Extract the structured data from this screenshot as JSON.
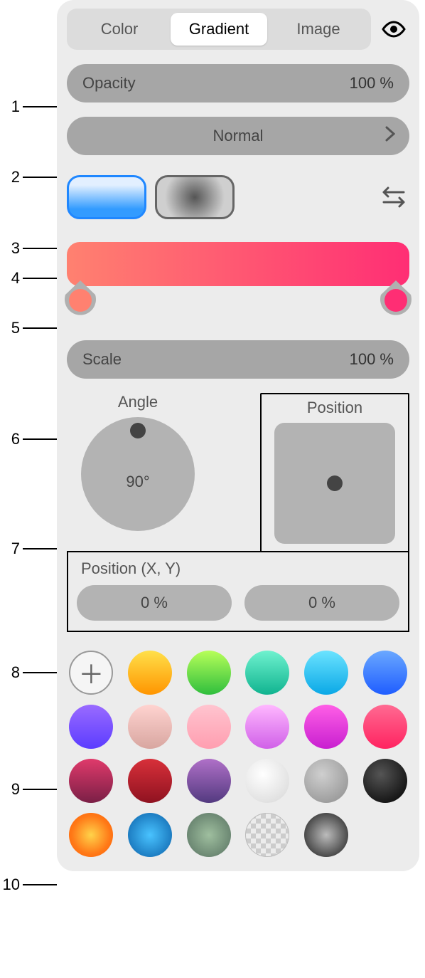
{
  "callouts": [
    "1",
    "2",
    "3",
    "4",
    "5",
    "6",
    "7",
    "8",
    "9",
    "10"
  ],
  "tabs": {
    "color": "Color",
    "gradient": "Gradient",
    "image": "Image",
    "active": "gradient"
  },
  "opacity": {
    "label": "Opacity",
    "value": "100 %"
  },
  "blend": {
    "label": "Normal"
  },
  "gradient": {
    "start_color": "#ff8170",
    "end_color": "#ff2e74"
  },
  "scale": {
    "label": "Scale",
    "value": "100 %"
  },
  "angle": {
    "label": "Angle",
    "value": "90°"
  },
  "position": {
    "label": "Position"
  },
  "position_xy": {
    "label": "Position (X, Y)",
    "x": "0 %",
    "y": "0 %"
  },
  "swatches": [
    {
      "name": "add",
      "type": "add"
    },
    {
      "name": "orange-yellow",
      "css": "linear-gradient(180deg,#ffe04a,#ff9500)"
    },
    {
      "name": "green",
      "css": "linear-gradient(180deg,#b7ff59,#2fbe3d)"
    },
    {
      "name": "teal",
      "css": "linear-gradient(180deg,#6ff2cf,#10b38f)"
    },
    {
      "name": "cyan",
      "css": "linear-gradient(180deg,#6be3ff,#0aa8e6)"
    },
    {
      "name": "blue",
      "css": "linear-gradient(180deg,#6aa8ff,#1f5dff)"
    },
    {
      "name": "violet",
      "css": "linear-gradient(180deg,#9a6bff,#5b3cff)"
    },
    {
      "name": "blush",
      "css": "linear-gradient(180deg,#ffd3d0,#d8a6a0)"
    },
    {
      "name": "pink-light",
      "css": "linear-gradient(180deg,#ffc4cf,#ff9eb0)"
    },
    {
      "name": "orchid",
      "css": "linear-gradient(180deg,#ffb8ff,#d060e8)"
    },
    {
      "name": "magenta",
      "css": "linear-gradient(180deg,#ff5fe6,#c81fd0)"
    },
    {
      "name": "hot-pink",
      "css": "linear-gradient(180deg,#ff6a92,#ff2360)"
    },
    {
      "name": "wine",
      "css": "linear-gradient(180deg,#e03a6b,#7a1f46)"
    },
    {
      "name": "crimson",
      "css": "linear-gradient(180deg,#d8303a,#8f1220)"
    },
    {
      "name": "dusk",
      "css": "linear-gradient(180deg,#b070c8,#533a80)"
    },
    {
      "name": "white",
      "css": "radial-gradient(circle at 40% 35%,#ffffff,#d6d6d6)"
    },
    {
      "name": "grey",
      "css": "radial-gradient(circle at 40% 35%,#cfcfcf,#8c8c8c)"
    },
    {
      "name": "black",
      "css": "radial-gradient(circle at 40% 35%,#555,#000)"
    },
    {
      "name": "sunset",
      "css": "radial-gradient(circle at 50% 50%,#ffd34a,#ff7a18 60%,#ff5a00)"
    },
    {
      "name": "ocean",
      "css": "radial-gradient(circle at 50% 50%,#49c3ff,#0a5fa8)"
    },
    {
      "name": "sage",
      "css": "radial-gradient(circle at 50% 50%,#9fbf9f,#567060)"
    },
    {
      "name": "transparent",
      "type": "checker"
    },
    {
      "name": "charcoal",
      "css": "radial-gradient(circle at 50% 50%,#bcbcbc,#1a1a1a)"
    }
  ]
}
